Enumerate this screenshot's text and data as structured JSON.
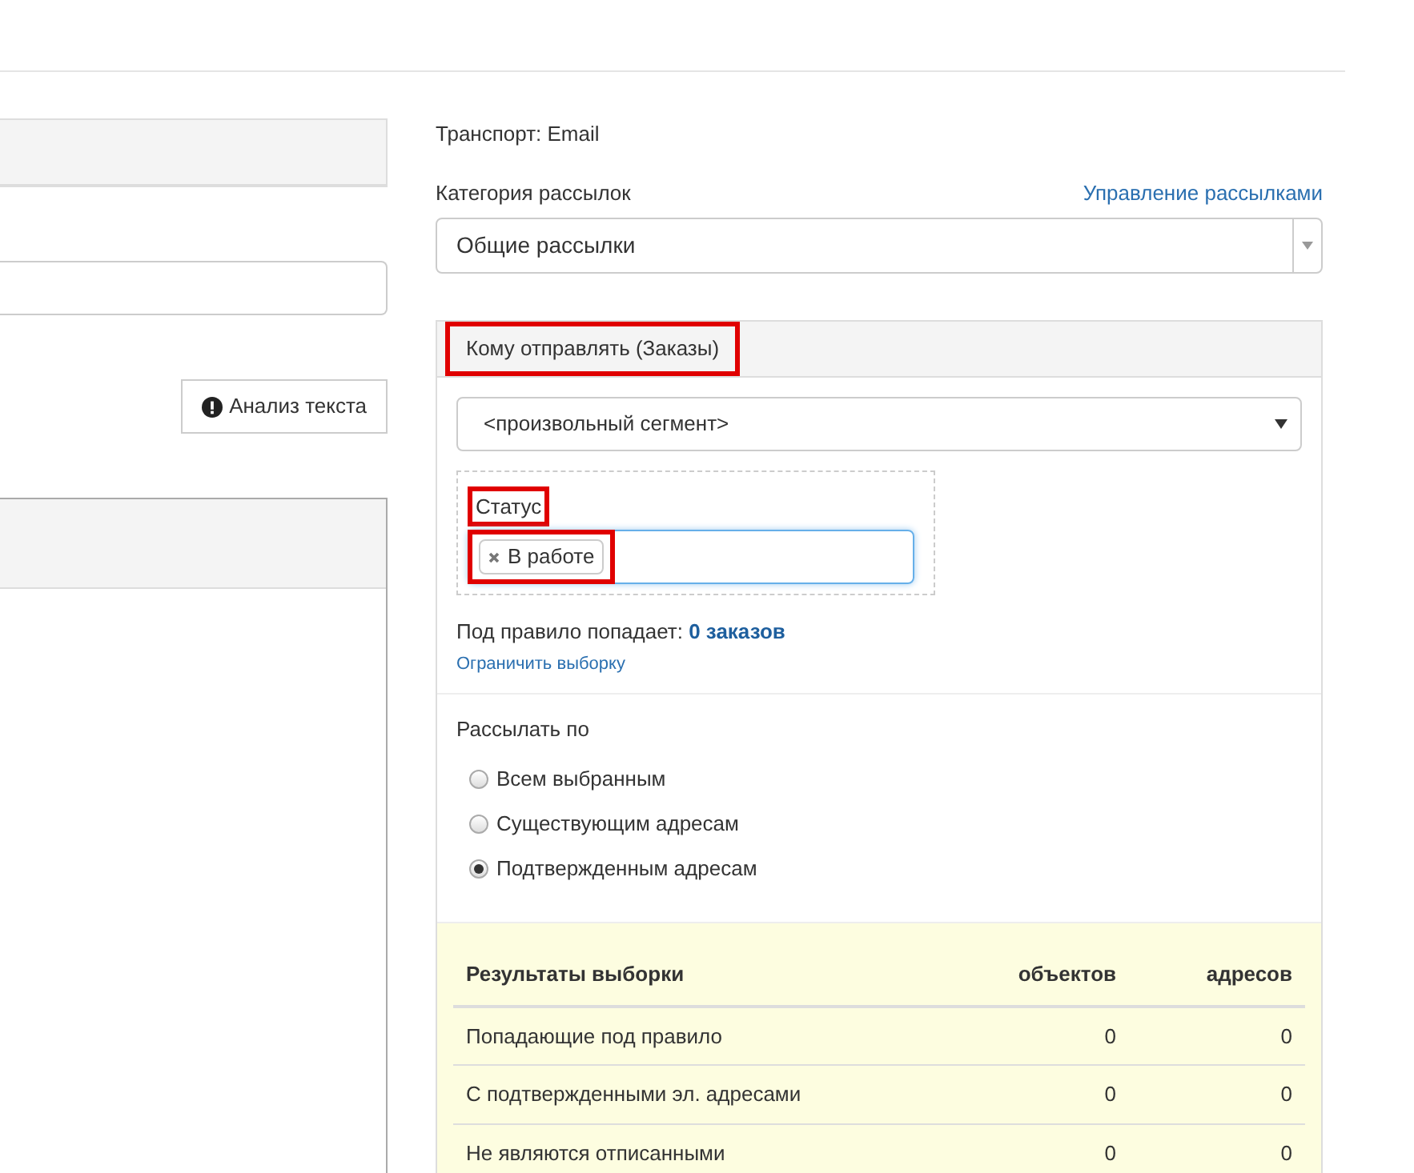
{
  "analyze_button": {
    "label": "Анализ текста"
  },
  "transport": "Транспорт: Email",
  "category": {
    "label": "Категория рассылок",
    "manage_link": "Управление рассылками",
    "value": "Общие рассылки"
  },
  "recipients": {
    "title": "Кому отправлять (Заказы)",
    "title_highlighted": true,
    "segment": "<произвольный сегмент>",
    "status_label": "Статус",
    "status_label_highlighted": true,
    "tags": [
      {
        "label": "В работе",
        "highlighted": true
      }
    ],
    "match_text": "Под правило попадает: ",
    "match_count": "0 заказов",
    "limit_link": "Ограничить выборку"
  },
  "send_by": {
    "label": "Рассылать по",
    "options": [
      {
        "label": "Всем выбранным",
        "selected": false
      },
      {
        "label": "Существующим адресам",
        "selected": false
      },
      {
        "label": "Подтвержденным адресам",
        "selected": true
      }
    ]
  },
  "results": {
    "columns": [
      "Результаты выборки",
      "объектов",
      "адресов"
    ],
    "rows": [
      [
        "Попадающие под правило",
        "0",
        "0"
      ],
      [
        "С подтвержденными эл. адресами",
        "0",
        "0"
      ],
      [
        "Не являются отписанными",
        "0",
        "0"
      ]
    ]
  }
}
